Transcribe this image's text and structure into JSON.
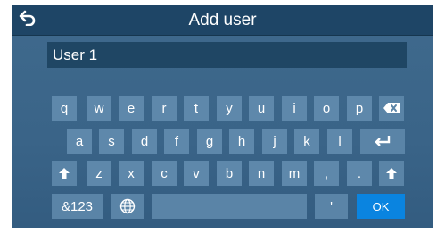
{
  "header": {
    "title": "Add user",
    "back_icon": "back-arrow-icon"
  },
  "input": {
    "value": "User 1"
  },
  "keyboard": {
    "row1": [
      "q",
      "w",
      "e",
      "r",
      "t",
      "y",
      "u",
      "i",
      "o",
      "p"
    ],
    "row2": [
      "a",
      "s",
      "d",
      "f",
      "g",
      "h",
      "j",
      "k",
      "l"
    ],
    "row3": [
      "z",
      "x",
      "c",
      "v",
      "b",
      "n",
      "m",
      ",",
      "."
    ],
    "row4": {
      "symbols": "&123",
      "apostrophe": "'",
      "ok": "OK"
    },
    "icons": {
      "backspace": "backspace-icon",
      "enter": "enter-icon",
      "shift": "shift-icon",
      "globe": "globe-icon"
    }
  },
  "colors": {
    "header": "#1e4566",
    "background": "#3f6a8d",
    "key": "#5e88ab",
    "input": "#1f4664",
    "ok_key": "#0a84e0"
  }
}
